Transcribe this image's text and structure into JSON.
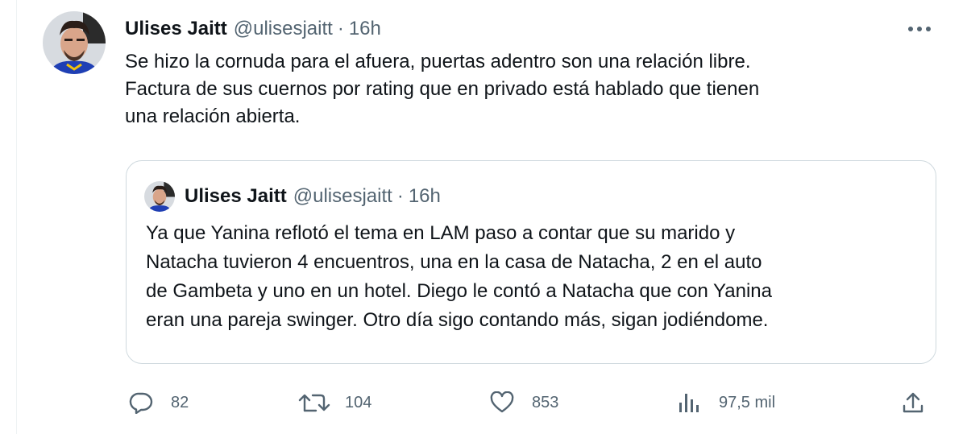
{
  "tweet": {
    "author_name": "Ulises Jaitt",
    "author_handle": "@ulisesjaitt",
    "separator": "·",
    "time": "16h",
    "text": "Se hizo la cornuda para el afuera, puertas adentro son una relación libre.\nFactura de sus cuernos por rating que en privado está hablado que tienen\nuna relación abierta."
  },
  "quoted_tweet": {
    "author_name": "Ulises Jaitt",
    "author_handle": "@ulisesjaitt",
    "separator": "·",
    "time": "16h",
    "text": "Ya que Yanina reflotó el tema en LAM paso a contar que su marido y\nNatacha tuvieron 4 encuentros, una en la casa de Natacha, 2 en el auto\nde Gambeta y uno en un hotel. Diego le contó a Natacha que con Yanina\neran una pareja swinger.  Otro día sigo contando más, sigan jodiéndome."
  },
  "actions": {
    "reply_count": "82",
    "retweet_count": "104",
    "like_count": "853",
    "views_count": "97,5 mil"
  },
  "icons": {
    "more": "more-dots-icon",
    "reply": "reply-icon",
    "retweet": "retweet-icon",
    "like": "heart-icon",
    "views": "views-chart-icon",
    "share": "share-icon"
  },
  "colors": {
    "text": "#0f1419",
    "secondary": "#536471",
    "border": "#cfd9de"
  }
}
